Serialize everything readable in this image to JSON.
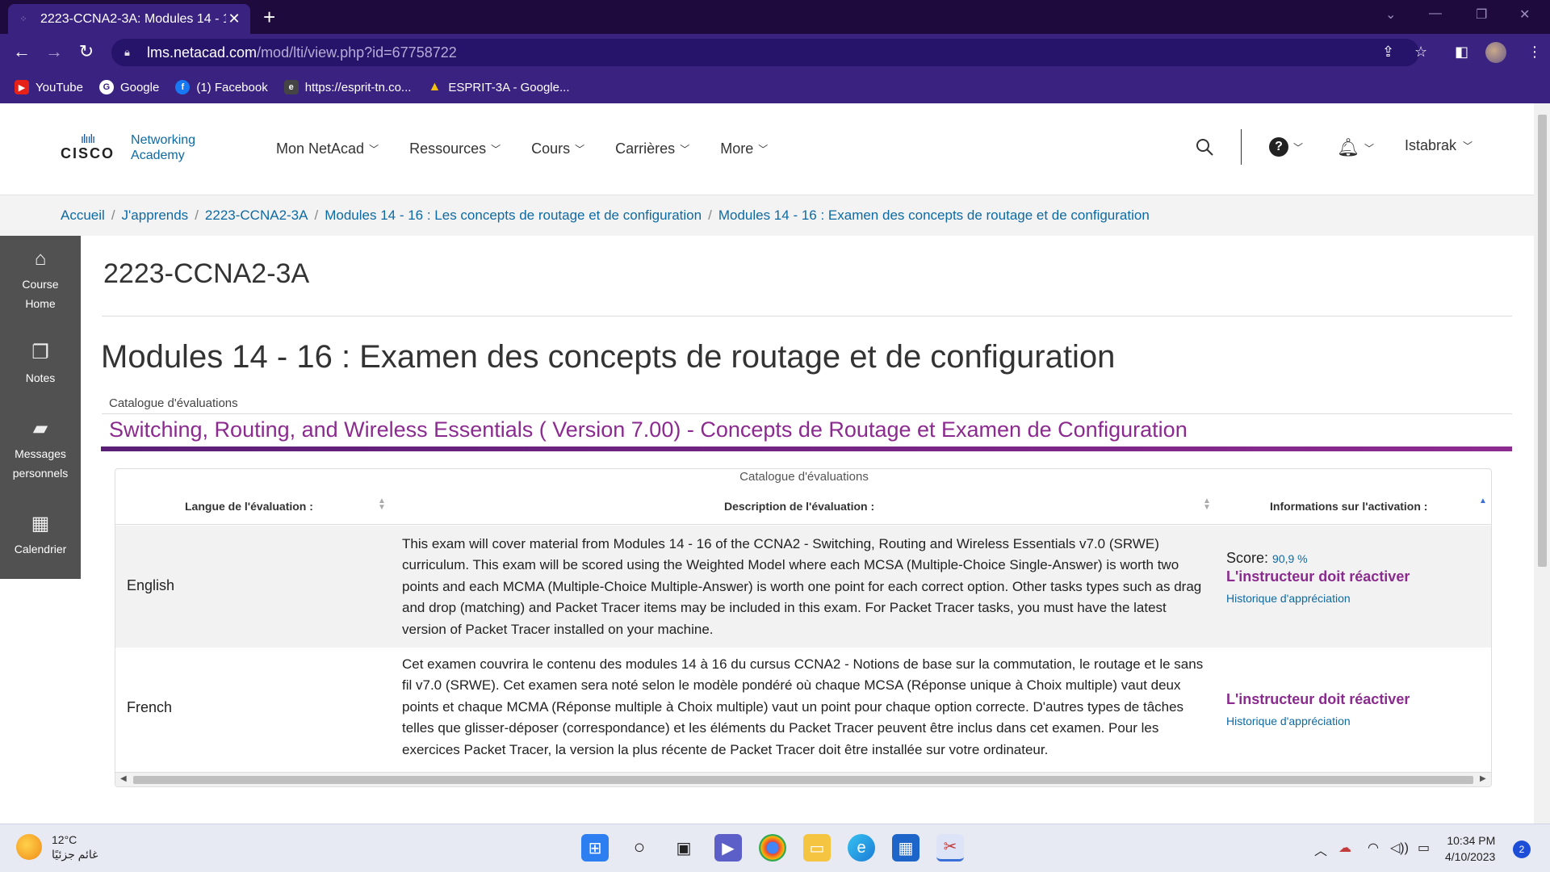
{
  "browser": {
    "tab_title": "2223-CCNA2-3A: Modules 14 - 1",
    "url_host": "lms.netacad.com",
    "url_path": "/mod/lti/view.php?id=67758722",
    "bookmarks": [
      {
        "label": "YouTube",
        "icon": "youtube-icon",
        "color": "#e62117"
      },
      {
        "label": "Google",
        "icon": "google-icon",
        "color": "#ffffff"
      },
      {
        "label": "(1) Facebook",
        "icon": "facebook-icon",
        "color": "#1877f2"
      },
      {
        "label": "https://esprit-tn.co...",
        "icon": "esprit-icon",
        "color": "#444444"
      },
      {
        "label": "ESPRIT-3A - Google...",
        "icon": "google-drive-icon",
        "color": "#34a853"
      }
    ]
  },
  "header": {
    "logo_line1": "Networking",
    "logo_line2": "Academy",
    "logo_word": "CISCO",
    "nav": [
      "Mon NetAcad",
      "Ressources",
      "Cours",
      "Carrières",
      "More"
    ],
    "user": "Istabrak"
  },
  "breadcrumb": [
    "Accueil",
    "J'apprends",
    "2223-CCNA2-3A",
    "Modules 14 - 16 : Les concepts de routage et de configuration",
    "Modules 14 - 16 : Examen des concepts de routage et de configuration"
  ],
  "sidebar": [
    {
      "label_1": "Course",
      "label_2": "Home",
      "icon": "home-icon"
    },
    {
      "label_1": "Notes",
      "label_2": "",
      "icon": "notes-icon"
    },
    {
      "label_1": "Messages",
      "label_2": "personnels",
      "icon": "messages-icon"
    },
    {
      "label_1": "Calendrier",
      "label_2": "",
      "icon": "calendar-icon"
    }
  ],
  "main": {
    "course_title": "2223-CCNA2-3A",
    "page_title": "Modules 14 - 16 : Examen des concepts de routage et de configuration",
    "catalog_label": "Catalogue d'évaluations",
    "assessment_title": "Switching, Routing, and Wireless Essentials ( Version 7.00) - Concepts de Routage et Examen de Configuration",
    "table": {
      "caption": "Catalogue d'évaluations",
      "headers": [
        "Langue de l'évaluation :",
        "Description de l'évaluation :",
        "Informations sur l'activation :"
      ],
      "rows": [
        {
          "language": "English",
          "description": "This exam will cover material from Modules 14 - 16 of the CCNA2 - Switching, Routing and Wireless Essentials v7.0 (SRWE) curriculum. This exam will be scored using the Weighted Model where each MCSA (Multiple-Choice Single-Answer) is worth two points and each MCMA (Multiple-Choice Multiple-Answer) is worth one point for each correct option. Other tasks types such as drag and drop (matching) and Packet Tracer items may be included in this exam. For Packet Tracer tasks, you must have the latest version of Packet Tracer installed on your machine.",
          "score_label": "Score:",
          "score_value": "90,9 %",
          "status": "L'instructeur doit réactiver",
          "history": "Historique d'appréciation"
        },
        {
          "language": "French",
          "description": "Cet examen couvrira le contenu des modules 14 à 16 du cursus CCNA2 - Notions de base sur la commutation, le routage et le sans fil v7.0 (SRWE). Cet examen sera noté selon le modèle pondéré où chaque MCSA (Réponse unique à Choix multiple) vaut deux points et chaque MCMA (Réponse multiple à Choix multiple) vaut un point pour chaque option correcte. D'autres types de tâches telles que glisser-déposer (correspondance) et les éléments du Packet Tracer peuvent être inclus dans cet examen. Pour les exercices Packet Tracer, la version la plus récente de Packet Tracer doit être installée sur votre ordinateur.",
          "status": "L'instructeur doit réactiver",
          "history": "Historique d'appréciation"
        }
      ]
    }
  },
  "taskbar": {
    "temp": "12°C",
    "weather_text": "غائم جزئيًا",
    "time": "10:34 PM",
    "date": "4/10/2023",
    "notif_count": "2"
  },
  "colors": {
    "accent_purple": "#8b2a8f",
    "link_blue": "#0d6aa3",
    "chrome": "#3a2280"
  }
}
